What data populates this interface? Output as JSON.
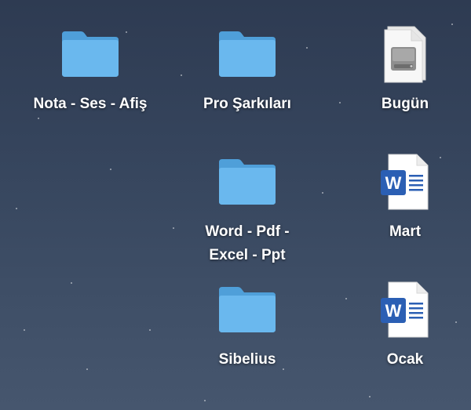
{
  "desktop": {
    "items": [
      {
        "label": "Nota - Ses - Afiş",
        "icon": "folder-icon"
      },
      {
        "label": "Pro Şarkıları",
        "icon": "folder-icon"
      },
      {
        "label": "Bugün",
        "icon": "disk-image-icon"
      },
      {
        "label": "Word - Pdf -\nExcel - Ppt",
        "icon": "folder-icon"
      },
      {
        "label": "Mart",
        "icon": "word-document-icon"
      },
      {
        "label": "Sibelius",
        "icon": "folder-icon"
      },
      {
        "label": "Ocak",
        "icon": "word-document-icon"
      }
    ]
  },
  "colors": {
    "folder_front": "#6ab8ee",
    "folder_back": "#4f9fd9",
    "word_blue": "#2b5fb4",
    "wallpaper_top": "#2e3b52",
    "wallpaper_bottom": "#46566e"
  },
  "word_glyph": "W"
}
